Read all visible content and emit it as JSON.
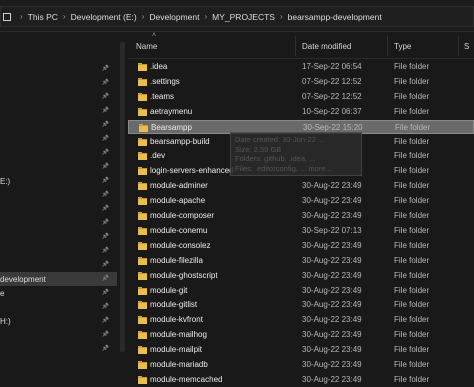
{
  "breadcrumb": [
    "This PC",
    "Development (E:)",
    "Development",
    "MY_PROJECTS",
    "bearsampp-development"
  ],
  "columns": {
    "name": "Name",
    "date": "Date modified",
    "type": "Type",
    "size": "S"
  },
  "nav": [
    {
      "label": "",
      "pinned": false
    },
    {
      "label": "",
      "pinned": false
    },
    {
      "label": "",
      "pinned": true
    },
    {
      "label": "",
      "pinned": true
    },
    {
      "label": "",
      "pinned": true
    },
    {
      "label": "",
      "pinned": true
    },
    {
      "label": "",
      "pinned": true
    },
    {
      "label": "",
      "pinned": true
    },
    {
      "label": "",
      "pinned": true
    },
    {
      "label": "",
      "pinned": true
    },
    {
      "label": "E:)",
      "pinned": true
    },
    {
      "label": "",
      "pinned": true
    },
    {
      "label": "",
      "pinned": true
    },
    {
      "label": "",
      "pinned": true
    },
    {
      "label": "",
      "pinned": true
    },
    {
      "label": "",
      "pinned": true
    },
    {
      "label": "",
      "pinned": true
    },
    {
      "label": "development",
      "pinned": true,
      "selected": true
    },
    {
      "label": "e",
      "pinned": true
    },
    {
      "label": "",
      "pinned": true
    },
    {
      "label": "H:)",
      "pinned": true
    },
    {
      "label": "",
      "pinned": true
    },
    {
      "label": "",
      "pinned": true
    }
  ],
  "rows": [
    {
      "name": ".idea",
      "date": "17-Sep-22 06:54",
      "type": "File folder"
    },
    {
      "name": ".settings",
      "date": "07-Sep-22 12:52",
      "type": "File folder"
    },
    {
      "name": ".teams",
      "date": "07-Sep-22 12:52",
      "type": "File folder"
    },
    {
      "name": "aetraymenu",
      "date": "10-Sep-22 06:37",
      "type": "File folder"
    },
    {
      "name": "Bearsampp",
      "date": "30-Sep-22 15:20",
      "type": "File folder",
      "selected": true
    },
    {
      "name": "bearsampp-build",
      "date": "",
      "type": "File folder"
    },
    {
      "name": ".dev",
      "date": "",
      "type": "File folder"
    },
    {
      "name": "login-servers-enhanced",
      "date": "",
      "type": "File folder"
    },
    {
      "name": "module-adminer",
      "date": "30-Aug-22 23:49",
      "type": "File folder"
    },
    {
      "name": "module-apache",
      "date": "30-Aug-22 23:49",
      "type": "File folder"
    },
    {
      "name": "module-composer",
      "date": "30-Aug-22 23:49",
      "type": "File folder"
    },
    {
      "name": "module-conemu",
      "date": "30-Sep-22 07:13",
      "type": "File folder"
    },
    {
      "name": "module-consolez",
      "date": "30-Aug-22 23:49",
      "type": "File folder"
    },
    {
      "name": "module-filezilla",
      "date": "30-Aug-22 23:49",
      "type": "File folder"
    },
    {
      "name": "module-ghostscript",
      "date": "30-Aug-22 23:49",
      "type": "File folder"
    },
    {
      "name": "module-git",
      "date": "30-Aug-22 23:49",
      "type": "File folder"
    },
    {
      "name": "module-gitlist",
      "date": "30-Aug-22 23:49",
      "type": "File folder"
    },
    {
      "name": "module-kvfront",
      "date": "30-Aug-22 23:49",
      "type": "File folder"
    },
    {
      "name": "module-mailhog",
      "date": "30-Aug-22 23:49",
      "type": "File folder"
    },
    {
      "name": "module-mailpit",
      "date": "30-Aug-22 23:49",
      "type": "File folder"
    },
    {
      "name": "module-mariadb",
      "date": "30-Aug-22 23:49",
      "type": "File folder"
    },
    {
      "name": "module-memcached",
      "date": "30-Aug-22 23:49",
      "type": "File folder"
    }
  ],
  "tooltip": {
    "created": "Date created: 30-Jun-22 ...",
    "size": "Size: 2.59 GB",
    "folders": "Folders: github, .idea, ...",
    "files": "Files: .editorconfig, ... more..."
  }
}
